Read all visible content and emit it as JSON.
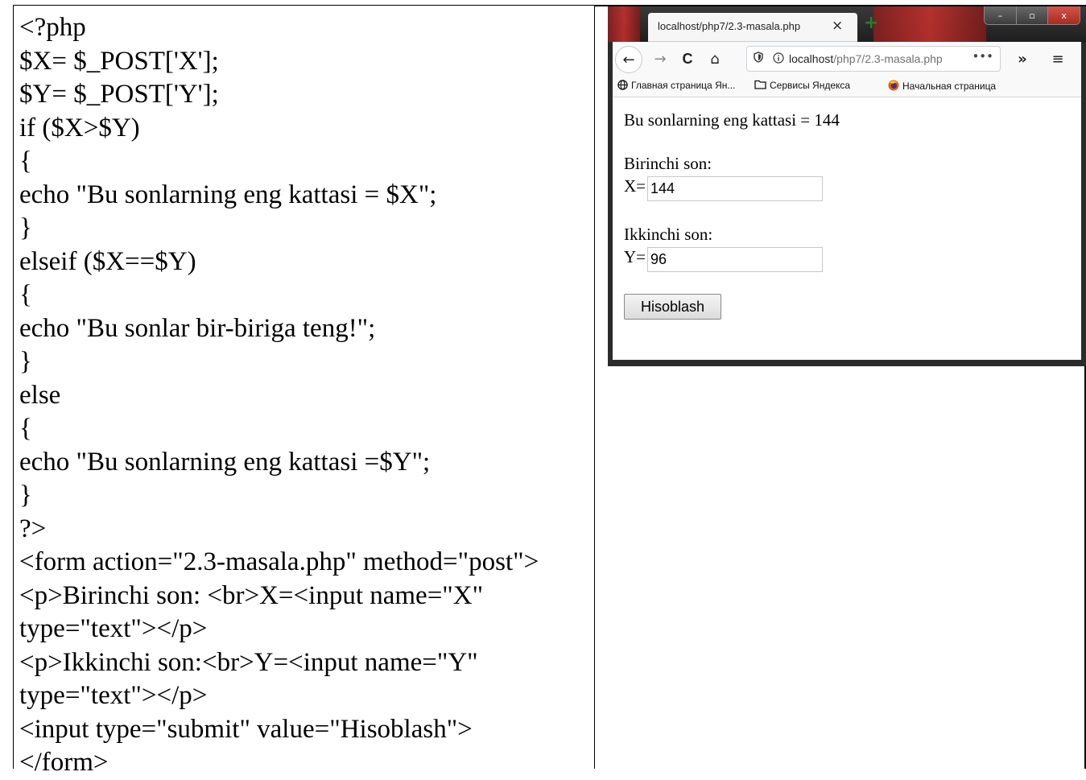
{
  "code": {
    "lines": [
      "<?php",
      "$X= $_POST['X'];",
      "$Y= $_POST['Y'];",
      "if ($X>$Y)",
      "{",
      "echo \"Bu sonlarning eng kattasi = $X\";",
      "}",
      "elseif ($X==$Y)",
      "{",
      "echo \"Bu sonlar bir-biriga teng!\";",
      "}",
      "else",
      "{",
      "echo \"Bu sonlarning eng kattasi =$Y\";",
      "}",
      "?>",
      "<form action=\"2.3-masala.php\" method=\"post\">",
      "<p>Birinchi son: <br>X=<input name=\"X\"",
      "type=\"text\"></p>",
      "<p>Ikkinchi son:<br>Y=<input name=\"Y\"",
      "type=\"text\"></p>",
      "<input type=\"submit\" value=\"Hisoblash\">",
      "</form>"
    ]
  },
  "browser": {
    "tab_title": "localhost/php7/2.3-masala.php",
    "tab_close": "×",
    "new_tab": "+",
    "window_buttons": {
      "minimize": "–",
      "maximize": "▫",
      "close": "x"
    },
    "toolbar": {
      "back": "←",
      "forward": "→",
      "reload": "C",
      "home": "⌂",
      "overflow": "»",
      "menu": "≡"
    },
    "url": {
      "host": "localhost",
      "path": "/php7/2.3-masala.php",
      "more": "•••"
    },
    "bookmarks": [
      {
        "label": "Главная страница Ян...",
        "icon": "globe-icon"
      },
      {
        "label": "Сервисы Яндекса",
        "icon": "folder-icon"
      },
      {
        "label": "Начальная страница",
        "icon": "firefox-icon"
      }
    ]
  },
  "page": {
    "result_text": "Bu sonlarning eng kattasi = 144",
    "first_label": "Birinchi son:",
    "x_prefix": "X=",
    "x_value": "144",
    "second_label": "Ikkinchi son:",
    "y_prefix": "Y=",
    "y_value": "96",
    "submit_label": "Hisoblash"
  }
}
